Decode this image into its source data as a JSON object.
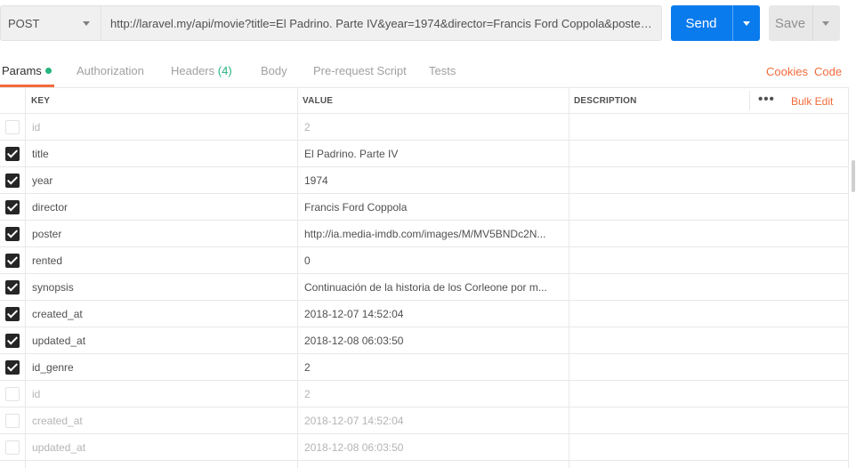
{
  "request": {
    "method": "POST",
    "url": "http://laravel.my/api/movie?title=El Padrino. Parte IV&year=1974&director=Francis Ford Coppola&poster=h...",
    "send_label": "Send",
    "save_label": "Save"
  },
  "tabs": [
    {
      "label": "Params",
      "active": true
    },
    {
      "label": "Authorization"
    },
    {
      "label": "Headers",
      "count": "(4)"
    },
    {
      "label": "Body"
    },
    {
      "label": "Pre-request Script"
    },
    {
      "label": "Tests"
    }
  ],
  "links": {
    "cookies": "Cookies",
    "code": "Code"
  },
  "table": {
    "headers": {
      "key": "KEY",
      "value": "VALUE",
      "description": "DESCRIPTION"
    },
    "more": "•••",
    "bulk_edit": "Bulk Edit",
    "rows": [
      {
        "checked": false,
        "key": "id",
        "value": "2",
        "description": ""
      },
      {
        "checked": true,
        "key": "title",
        "value": "El Padrino. Parte IV",
        "description": ""
      },
      {
        "checked": true,
        "key": "year",
        "value": "1974",
        "description": ""
      },
      {
        "checked": true,
        "key": "director",
        "value": "Francis Ford Coppola",
        "description": ""
      },
      {
        "checked": true,
        "key": "poster",
        "value": "http://ia.media-imdb.com/images/M/MV5BNDc2N...",
        "description": ""
      },
      {
        "checked": true,
        "key": "rented",
        "value": "0",
        "description": ""
      },
      {
        "checked": true,
        "key": "synopsis",
        "value": "Continuación de la historia de los Corleone por m...",
        "description": ""
      },
      {
        "checked": true,
        "key": "created_at",
        "value": "2018-12-07 14:52:04",
        "description": ""
      },
      {
        "checked": true,
        "key": "updated_at",
        "value": "2018-12-08 06:03:50",
        "description": ""
      },
      {
        "checked": true,
        "key": "id_genre",
        "value": "2",
        "description": ""
      },
      {
        "checked": false,
        "key": "id",
        "value": "2",
        "description": ""
      },
      {
        "checked": false,
        "key": "created_at",
        "value": "2018-12-07 14:52:04",
        "description": ""
      },
      {
        "checked": false,
        "key": "updated_at",
        "value": "2018-12-08 06:03:50",
        "description": ""
      }
    ]
  },
  "colors": {
    "accent": "#f26b3a",
    "send": "#097bed",
    "status_dot": "#26b47f"
  }
}
